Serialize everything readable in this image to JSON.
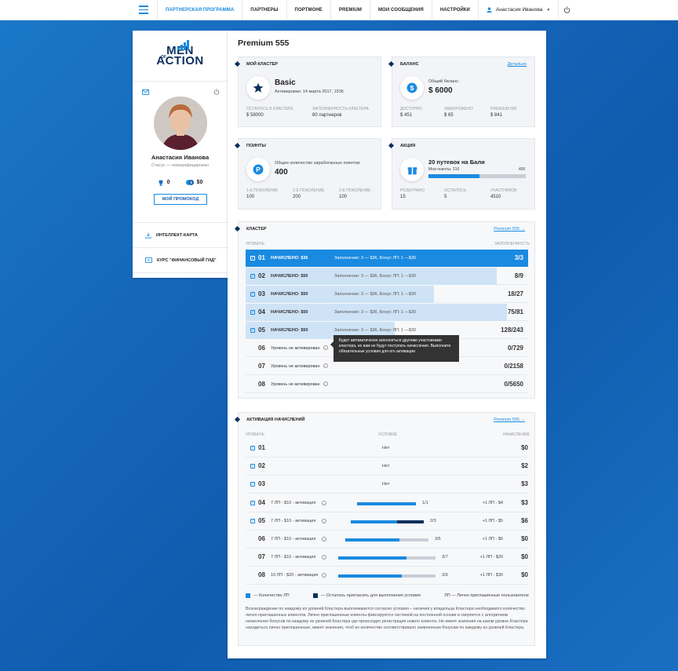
{
  "topbar": {
    "nav": [
      "Партнерская программа",
      "Партнеры",
      "Портмоне",
      "Premium",
      "Мои сообщения",
      "Настройки"
    ],
    "user_name": "Анастасия Иванова"
  },
  "sidebar": {
    "logo_of": "OF",
    "logo_men": "MEN",
    "logo_action": "ACTION",
    "name": "Анастасия Иванова",
    "status": "Статус — неверифицирован",
    "trophy_count": "0",
    "coins": "$0",
    "promo_button": "Мой промокод",
    "links": [
      "Интеллект-карта",
      "Курс \"Финансовый гид\""
    ]
  },
  "main": {
    "title": "Premium 555",
    "cluster_card": {
      "title": "Мой кластер",
      "name": "Basic",
      "activated": "Активирован: 14 марта 2017, 1536",
      "label1": "Осталось в кластере",
      "value1": "$ 58000",
      "label2": "Заполненность кластера",
      "value2": "80 партнеров"
    },
    "balance_card": {
      "title": "Баланс",
      "link": "Детально",
      "total_label": "Общий баланс:",
      "total": "$ 6000",
      "label1": "Доступно",
      "value1": "$ 451",
      "label2": "Заморожено",
      "value2": "$ 65",
      "label3": "Premium 555",
      "value3": "$ 841"
    },
    "points_card": {
      "title": "Поинты",
      "total_label": "Общее количество заработанных поинтов:",
      "total": "400",
      "label1": "1-е поколение",
      "value1": "100",
      "label2": "2-е поколение",
      "value2": "200",
      "label3": "3-е поколение",
      "value3": "100"
    },
    "promo_card": {
      "title": "Акция",
      "name": "20 путевок на Бали",
      "my_points": "Мои поинты: 210",
      "max": "400",
      "progress": 0.525,
      "label1": "Розыграно",
      "value1": "15",
      "label2": "Осталось",
      "value2": "5",
      "label3": "Участников",
      "value3": "4510"
    },
    "cluster": {
      "title": "Кластер",
      "link": "Premium 555 →",
      "col_level": "Уровень",
      "col_fill": "Заполненность",
      "rows": [
        {
          "num": "01",
          "status": "НАЧИСЛЕНО: $36",
          "cond": "Заполнение: 3 — $36, Бонус ЛП: 1 —$30",
          "fill": "3/3",
          "ratio": 1,
          "checked": true,
          "active": true
        },
        {
          "num": "02",
          "status": "НАЧИСЛЕНО: $50",
          "cond": "Заполнение: 3 — $36, Бонус ЛП: 1 —$30",
          "fill": "8/9",
          "ratio": 0.889,
          "checked": true,
          "active": false
        },
        {
          "num": "03",
          "status": "НАЧИСЛЕНО: $50",
          "cond": "Заполнение: 3 — $36, Бонус ЛП: 1 —$30",
          "fill": "18/27",
          "ratio": 0.667,
          "checked": true,
          "active": false
        },
        {
          "num": "04",
          "status": "НАЧИСЛЕНО: $50",
          "cond": "Заполнение: 3 — $36, Бонус ЛП: 1 —$30",
          "fill": "75/81",
          "ratio": 0.926,
          "checked": true,
          "active": false
        },
        {
          "num": "05",
          "status": "НАЧИСЛЕНО: $50",
          "cond": "Заполнение: 3 — $36, Бонус ЛП: 1 —$30",
          "fill": "128/243",
          "ratio": 0.527,
          "checked": true,
          "active": false
        },
        {
          "num": "06",
          "status": "Уровень не активирован",
          "cond": "",
          "fill": "0/729",
          "ratio": 0,
          "checked": false,
          "active": false
        },
        {
          "num": "07",
          "status": "Уровень не активирован",
          "cond": "",
          "fill": "0/2158",
          "ratio": 0,
          "checked": false,
          "active": false
        },
        {
          "num": "08",
          "status": "Уровень не активирован",
          "cond": "",
          "fill": "0/5650",
          "ratio": 0,
          "checked": false,
          "active": false
        }
      ],
      "tooltip": "Будет автоматически заполняться другими участниками кластера, но вам не будут поступать начисления. Выполните обязательные условия для его активации"
    },
    "activation": {
      "title": "Активация начислений",
      "link": "Premium 555 →",
      "col_level": "Уровень",
      "col_cond": "Условие",
      "col_accr": "Начисление",
      "rows": [
        {
          "num": "01",
          "cond": "",
          "mid": "Нет",
          "frac": "",
          "bonus": "",
          "amt": "$0",
          "checked": true,
          "a": 0,
          "b": 0
        },
        {
          "num": "02",
          "cond": "",
          "mid": "Нет",
          "frac": "",
          "bonus": "",
          "amt": "$2",
          "checked": true,
          "a": 0,
          "b": 0
        },
        {
          "num": "03",
          "cond": "",
          "mid": "Нет",
          "frac": "",
          "bonus": "",
          "amt": "$3",
          "checked": true,
          "a": 0,
          "b": 0
        },
        {
          "num": "04",
          "cond": "7 ЛП - $10 - активация",
          "mid": "",
          "frac": "1/1",
          "bonus": "+1 ЛП - $4",
          "amt": "$3",
          "checked": true,
          "a": 1,
          "b": 0
        },
        {
          "num": "05",
          "cond": "7 ЛП - $10 - активация",
          "mid": "",
          "frac": "2/3",
          "bonus": "+1 ЛП - $5",
          "amt": "$6",
          "checked": true,
          "a": 0.63,
          "b": 0.37
        },
        {
          "num": "06",
          "cond": "7 ЛП - $10 - активация",
          "mid": "",
          "frac": "3/5",
          "bonus": "+1 ЛП - $6",
          "amt": "$0",
          "checked": false,
          "a": 0.65,
          "b": 0
        },
        {
          "num": "07",
          "cond": "7 ЛП - $10 - активация",
          "mid": "",
          "frac": "3/7",
          "bonus": "+1 ЛП - $20",
          "amt": "$0",
          "checked": false,
          "a": 0.7,
          "b": 0
        },
        {
          "num": "08",
          "cond": "10 ЛП - $20 - активация",
          "mid": "",
          "frac": "3/9",
          "bonus": "+1 ЛП - $30",
          "amt": "$0",
          "checked": false,
          "a": 0.65,
          "b": 0
        }
      ],
      "legend": [
        "— Количество ЛП",
        "— Осталось пригласить для выполнения условия",
        "ЛП — Лично приглашенные пользователи"
      ],
      "note": "Вознаграждение по каждому из уровней Кластера выплачивается согласно условия – наличия у владельца Кластера необходимого количество лично приглашенных клиентов. Лично приглашенные клиенты фиксируются системой на постоянной основе и сверяется с алгоритмом начисления бонусов по каждому из уровней Кластера где происходит регистрация нового клиента. Не имеет значения на каком уровне Кластера находиться лично приглашенные, имеет значения, чтоб их количество соответствовало заявленным бонусам по каждому из уровней Кластера."
    }
  },
  "colors": {
    "accent": "#1a8ae0",
    "dark": "#0d2f5c",
    "fill_light": "#cfe3f6",
    "grey": "#c9ced6"
  }
}
